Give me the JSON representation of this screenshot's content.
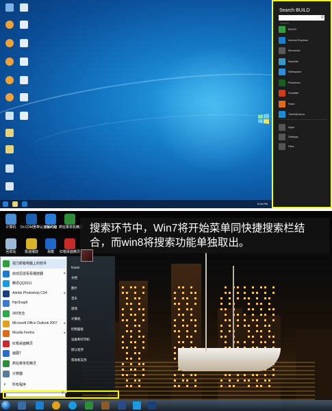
{
  "charm": {
    "title": "Search BUILD",
    "search_placeholder": "Search",
    "apps": [
      {
        "label": "BUILD",
        "color": "#2f9e3e"
      },
      {
        "label": "Internet Explorer",
        "color": "#1a7fd0"
      },
      {
        "label": "Memories",
        "color": "#5a5a5a"
      },
      {
        "label": "Nearfolk",
        "color": "#3399cc"
      },
      {
        "label": "Notespace",
        "color": "#2f8de0"
      },
      {
        "label": "Picstream",
        "color": "#1b5e20"
      },
      {
        "label": "Socialite",
        "color": "#d23b1a"
      },
      {
        "label": "Store",
        "color": "#e06a1a"
      },
      {
        "label": "Tweet@rama",
        "color": "#1a8cd8"
      }
    ],
    "categories": [
      "Apps",
      "Settings",
      "Files"
    ]
  },
  "caption": {
    "text": "搜索环节中，Win7将开始菜单同快捷搜索栏结合，而win8将搜索功能单独取出。"
  },
  "desktop7_icons": [
    {
      "label": "计算机",
      "color": "#4a8fd6"
    },
    {
      "label": "Dr.COM宽带认证客户端",
      "color": "#1a5fb0"
    },
    {
      "label": "WebQQ",
      "color": "#2a7ad8"
    },
    {
      "label": "疯狂菜单机精灵",
      "color": "#2e8b3a"
    },
    {
      "label": "回收站",
      "color": "#9fb8d8"
    },
    {
      "label": "极速播放",
      "color": "#d8b32a"
    },
    {
      "label": "易酷",
      "color": "#1f66c8"
    },
    {
      "label": "红帽桌面精灵",
      "color": "#c82a2a"
    }
  ],
  "start_menu": {
    "items": [
      {
        "label": "强力卸载电脑上的软件",
        "color": "#2e9e3a",
        "arrow": false
      },
      {
        "label": "启动迅雷看看播放器",
        "color": "#1a7bd0",
        "arrow": true
      },
      {
        "label": "腾讯QQ2011",
        "color": "#1a9be0",
        "arrow": false
      },
      {
        "label": "Adobe Photoshop CS4",
        "color": "#1b3f7a",
        "arrow": true
      },
      {
        "label": "HprSnap6",
        "color": "#3a7ad0",
        "arrow": false
      },
      {
        "label": "360安全",
        "color": "#2aa84a",
        "arrow": false
      },
      {
        "label": "Microsoft Office Outlook 2007",
        "color": "#e0a21a",
        "arrow": true
      },
      {
        "label": "Mozilla Firefox",
        "color": "#e0661a",
        "arrow": true
      },
      {
        "label": "红帽桌面精灵",
        "color": "#c82a2a",
        "arrow": false
      },
      {
        "label": "画图7",
        "color": "#2a6ac8",
        "arrow": false
      },
      {
        "label": "疯狂菜单机精灵",
        "color": "#2e8b3a",
        "arrow": false
      },
      {
        "label": "计算器",
        "color": "#5a7a9a",
        "arrow": false
      }
    ],
    "all_programs": "所有程序",
    "right_items": [
      "fxiaolc",
      "文档",
      "图片",
      "音乐",
      "游戏",
      "计算机",
      "控制面板",
      "设备和打印机",
      "默认程序",
      "帮助和支持"
    ],
    "search_placeholder": ""
  },
  "top_taskbar_clock": "5:26 PM",
  "colors": {
    "highlight": "#f4ff00",
    "charm_bg": "#1d1d1d",
    "w8_sky": "#1479c6"
  }
}
